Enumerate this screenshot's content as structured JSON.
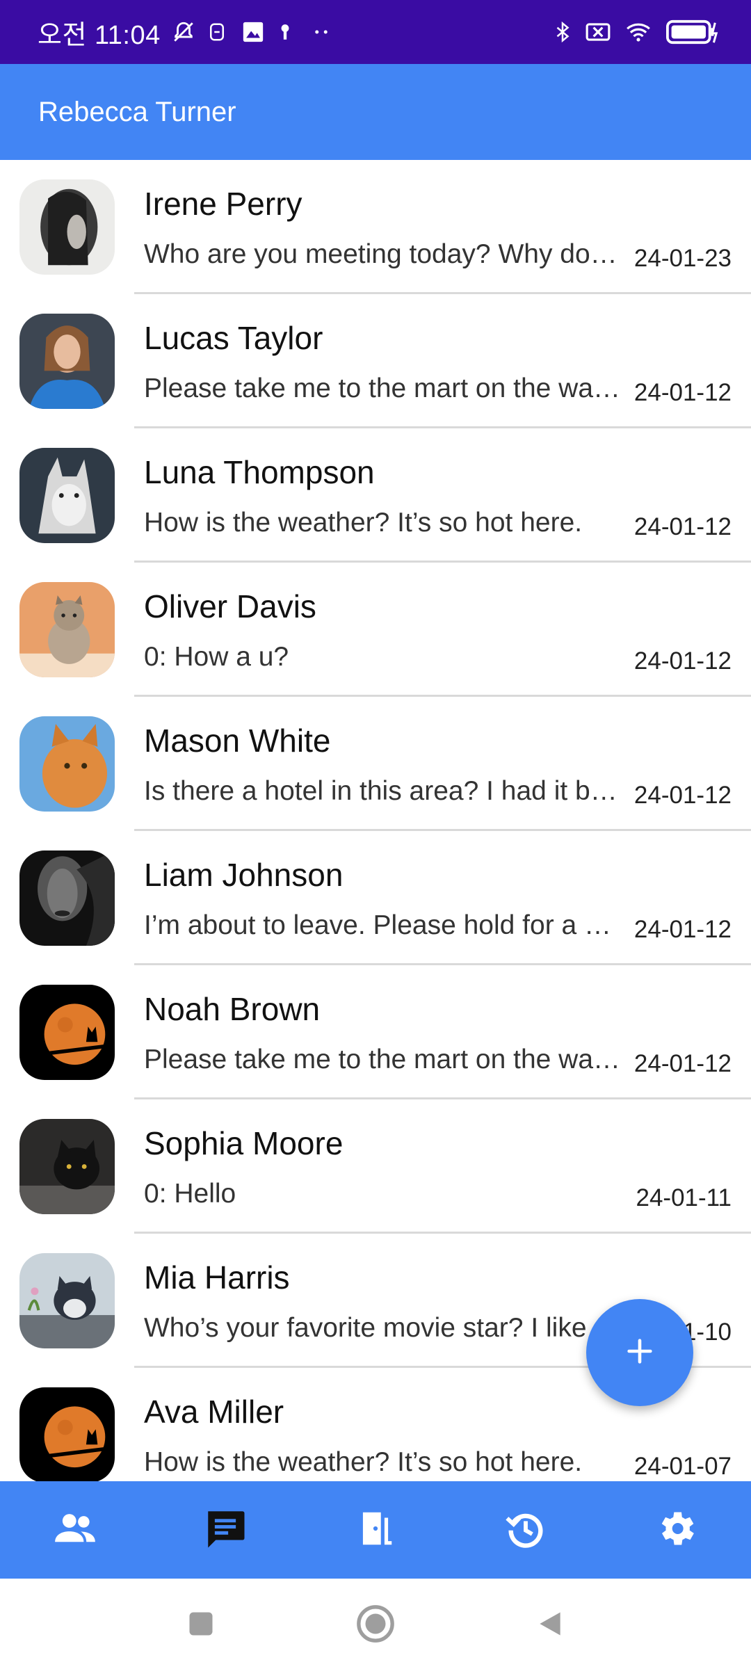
{
  "status_bar": {
    "time": "오전 11:04",
    "icons": [
      "mute-icon",
      "sim-icon",
      "gallery-icon",
      "key-icon",
      "more-dots-icon",
      "bluetooth-icon",
      "no-sim-icon",
      "wifi-icon",
      "battery-charging-icon"
    ]
  },
  "app_bar": {
    "title": "Rebecca Turner"
  },
  "chats": [
    {
      "name": "Irene Perry",
      "preview": "Who are you meeting today? Why don't you tell me",
      "date": "24-01-23",
      "avatar": "woman-hair-portrait"
    },
    {
      "name": "Lucas Taylor",
      "preview": "Please take me to the mart on the way home",
      "date": "24-01-12",
      "avatar": "woman-blue-dress"
    },
    {
      "name": "Luna Thompson",
      "preview": "How is the weather? It’s so hot here.",
      "date": "24-01-12",
      "avatar": "wolf"
    },
    {
      "name": "Oliver Davis",
      "preview": "0: How a u?",
      "date": "24-01-12",
      "avatar": "sitting-cat"
    },
    {
      "name": "Mason White",
      "preview": "Is there a hotel in this area? I had it booked",
      "date": "24-01-12",
      "avatar": "orange-cat"
    },
    {
      "name": "Liam Johnson",
      "preview": "I’m about to leave. Please hold for a moment",
      "date": "24-01-12",
      "avatar": "dark-face"
    },
    {
      "name": "Noah Brown",
      "preview": "Please take me to the mart on the way home",
      "date": "24-01-12",
      "avatar": "moon-cat"
    },
    {
      "name": "Sophia Moore",
      "preview": "0: Hello",
      "date": "24-01-11",
      "avatar": "black-cat"
    },
    {
      "name": "Mia Harris",
      "preview": "Who’s your favorite movie star? I like",
      "date": "24-01-10",
      "avatar": "kitten"
    },
    {
      "name": "Ava Miller",
      "preview": "How is the weather? It’s so hot here.",
      "date": "24-01-07",
      "avatar": "moon-cat"
    }
  ],
  "fab": {
    "icon": "plus-icon"
  },
  "bottom_nav": [
    {
      "icon": "people-icon",
      "active": false
    },
    {
      "icon": "chat-icon",
      "active": true
    },
    {
      "icon": "door-icon",
      "active": false
    },
    {
      "icon": "history-icon",
      "active": false
    },
    {
      "icon": "settings-icon",
      "active": false
    }
  ],
  "system_nav": [
    "recents-button",
    "home-button",
    "back-button"
  ],
  "colors": {
    "status_bar": "#3a0ca3",
    "primary": "#4285f4",
    "active_icon": "#111111",
    "icon": "#ffffff"
  }
}
